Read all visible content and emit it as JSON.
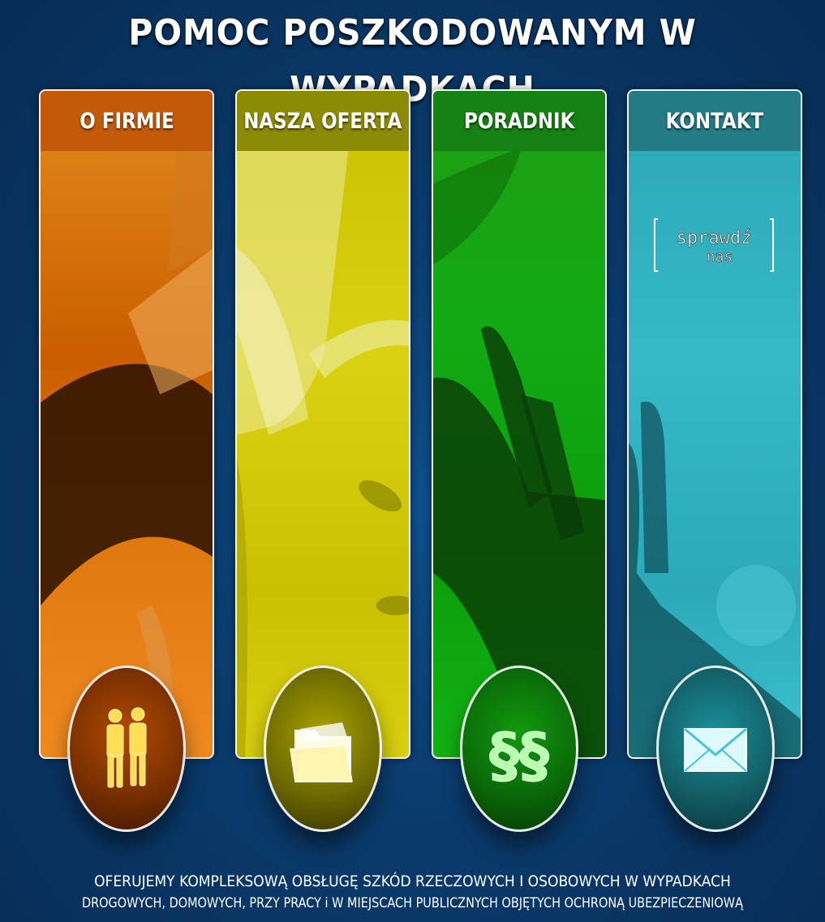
{
  "header": {
    "title": "POMOC POSZKODOWANYM W WYPADKACH"
  },
  "panels": [
    {
      "label": "O FIRMIE",
      "icon": "people-icon",
      "color": "#c25a0a"
    },
    {
      "label": "NASZA OFERTA",
      "icon": "folder-icon",
      "color": "#8d8a07"
    },
    {
      "label": "PORADNIK",
      "icon": "paragraph-icon",
      "color": "#158013"
    },
    {
      "label": "KONTAKT",
      "icon": "envelope-icon",
      "color": "#237b85"
    }
  ],
  "stamp": {
    "main": "sprawdź",
    "sub": "nas"
  },
  "footer": {
    "line1": "OFERUJEMY KOMPLEKSOWĄ OBSŁUGĘ SZKÓD RZECZOWYCH I OSOBOWYCH W WYPADKACH",
    "line2": "DROGOWYCH, DOMOWYCH, PRZY PRACY i W MIEJSCACH PUBLICZNYCH OBJĘTYCH OCHRONĄ UBEZPIECZENIOWĄ"
  }
}
